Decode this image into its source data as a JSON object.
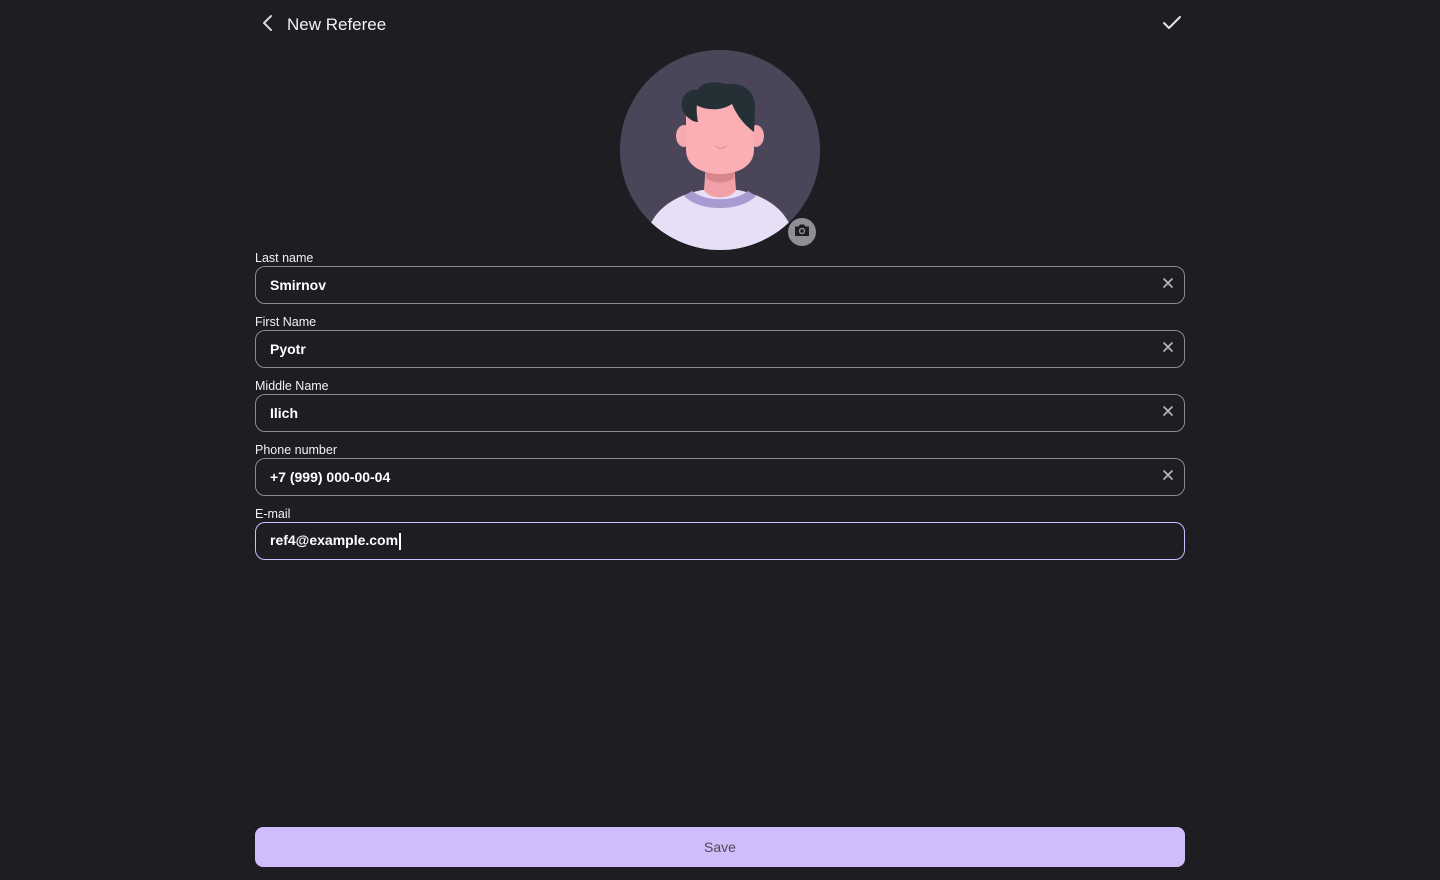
{
  "header": {
    "title": "New Referee",
    "back_icon": "chevron-left-icon",
    "confirm_icon": "check-icon"
  },
  "avatar": {
    "camera_icon": "camera-icon"
  },
  "fields": [
    {
      "label": "Last name",
      "value": "Smirnov",
      "clearable": true
    },
    {
      "label": "First Name",
      "value": "Pyotr",
      "clearable": true
    },
    {
      "label": "Middle Name",
      "value": "Ilich",
      "clearable": true
    },
    {
      "label": "Phone number",
      "value": "+7 (999) 000-00-04",
      "clearable": true
    },
    {
      "label": "E-mail",
      "value": "ref4@example.com",
      "focused": true
    }
  ],
  "save_label": "Save",
  "colors": {
    "background": "#1d1d22",
    "accent": "#cfbdfb",
    "focus_border": "#d0bcff"
  }
}
